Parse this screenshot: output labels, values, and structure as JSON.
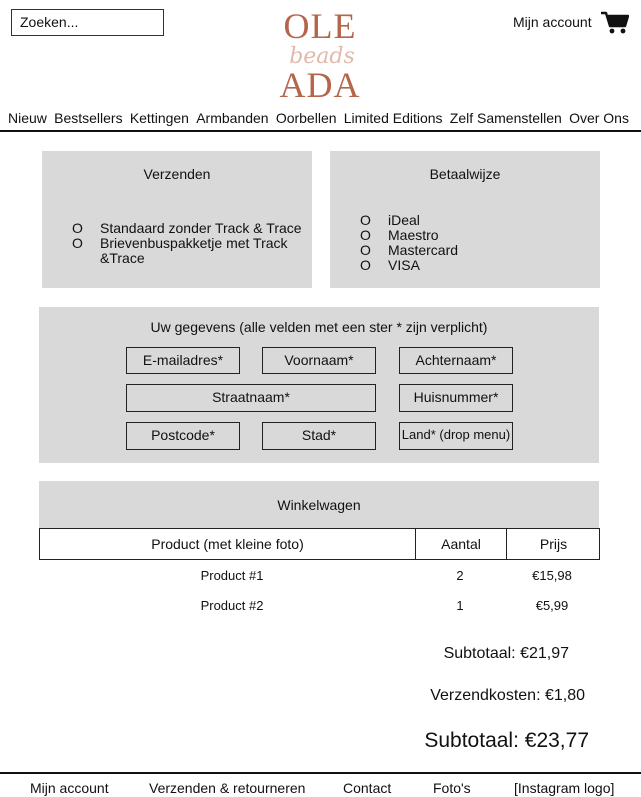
{
  "header": {
    "search_placeholder": "Zoeken...",
    "account_label": "Mijn account",
    "logo": {
      "line1": "OLE",
      "script": "beads",
      "line2": "ADA"
    }
  },
  "nav": [
    "Nieuw",
    "Bestsellers",
    "Kettingen",
    "Armbanden",
    "Oorbellen",
    "Limited Editions",
    "Zelf Samenstellen",
    "Over Ons"
  ],
  "shipping": {
    "title": "Verzenden",
    "options": [
      {
        "mark": "O",
        "label": "Standaard zonder Track & Trace"
      },
      {
        "mark": "O",
        "label": "Brievenbuspakketje met Track &Trace"
      }
    ]
  },
  "payment": {
    "title": "Betaalwijze",
    "options": [
      {
        "mark": "O",
        "label": "iDeal"
      },
      {
        "mark": "O",
        "label": "Maestro"
      },
      {
        "mark": "O",
        "label": "Mastercard"
      },
      {
        "mark": "O",
        "label": "VISA"
      }
    ]
  },
  "details": {
    "title": "Uw gegevens (alle velden met een ster * zijn verplicht)",
    "fields": {
      "email": "E-mailadres*",
      "firstname": "Voornaam*",
      "lastname": "Achternaam*",
      "street": "Straatnaam*",
      "housenumber": "Huisnummer*",
      "postcode": "Postcode*",
      "city": "Stad*",
      "country": "Land* (drop menu)"
    }
  },
  "cart": {
    "title": "Winkelwagen",
    "columns": [
      "Product (met kleine foto)",
      "Aantal",
      "Prijs"
    ],
    "rows": [
      {
        "product": "Product #1",
        "qty": "2",
        "price": "€15,98"
      },
      {
        "product": "Product #2",
        "qty": "1",
        "price": "€5,99"
      }
    ],
    "subtotal": "Subtotaal: €21,97",
    "shipping": "Verzendkosten: €1,80",
    "total": "Subtotaal: €23,77"
  },
  "footer": [
    "Mijn account",
    "Verzenden & retourneren",
    "Contact",
    "Foto's",
    "[Instagram logo]"
  ],
  "colors": {
    "panel": "#d9d9d9",
    "logo": "#b5654a"
  }
}
